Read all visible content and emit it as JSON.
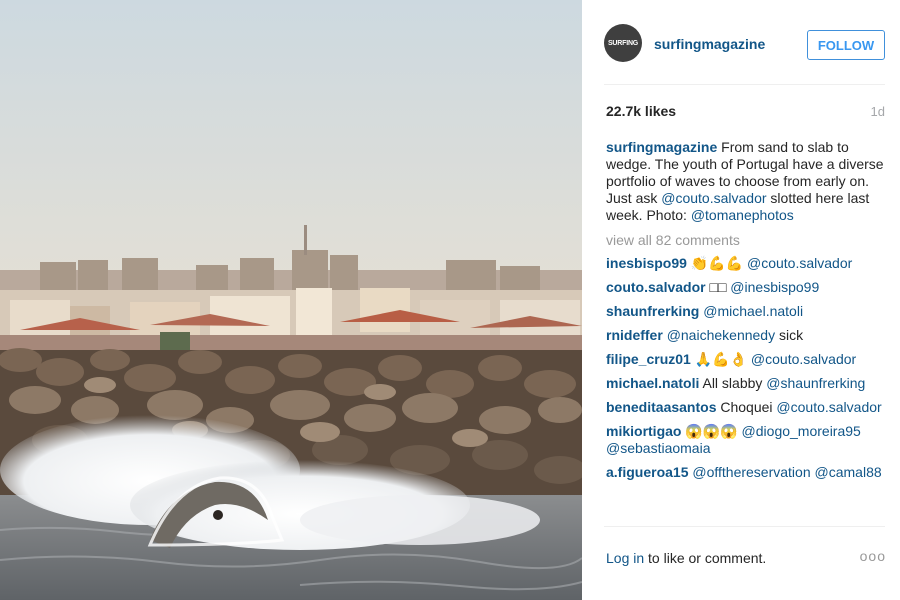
{
  "post": {
    "username": "surfingmagazine",
    "avatar_text": "SURFING",
    "follow_label": "FOLLOW",
    "likes": "22.7k likes",
    "age": "1d",
    "caption": {
      "username": "surfingmagazine",
      "text1": " From sand to slab to wedge. The youth of Portugal have a diverse portfolio of waves to choose from early on. Just ask ",
      "mention1": "@couto.salvador",
      "text2": " slotted here last week. Photo: ",
      "mention2": "@tomanephotos"
    },
    "view_all": "view all 82 comments"
  },
  "comments": [
    {
      "user": "inesbispo99",
      "pre": "👏💪💪 ",
      "mention": "@couto.salvador",
      "post": ""
    },
    {
      "user": "couto.salvador",
      "pre": "□□ ",
      "mention": "@inesbispo99",
      "post": ""
    },
    {
      "user": "shaunfrerking",
      "pre": "",
      "mention": "@michael.natoli",
      "post": ""
    },
    {
      "user": "rnideffer",
      "pre": "",
      "mention": "@naichekennedy",
      "post": " sick"
    },
    {
      "user": "filipe_cruz01",
      "pre": "🙏💪👌 ",
      "mention": "@couto.salvador",
      "post": ""
    },
    {
      "user": "michael.natoli",
      "pre": "All slabby ",
      "mention": "@shaunfrerking",
      "post": ""
    },
    {
      "user": "beneditaasantos",
      "pre": "Choquei ",
      "mention": "@couto.salvador",
      "post": ""
    },
    {
      "user": "mikiortigao",
      "pre": "😱😱😱 ",
      "mention": "@diogo_moreira95 @sebastiaomaia",
      "post": ""
    },
    {
      "user": "a.figueroa15",
      "pre": "",
      "mention": "@offthereservation @camal88",
      "post": ""
    }
  ],
  "footer": {
    "login": "Log in",
    "rest": " to like or comment.",
    "more": "ooo"
  },
  "colors": {
    "link": "#125688",
    "follow": "#3897f0",
    "muted": "#999999"
  },
  "icons": [
    "more-options-icon"
  ]
}
